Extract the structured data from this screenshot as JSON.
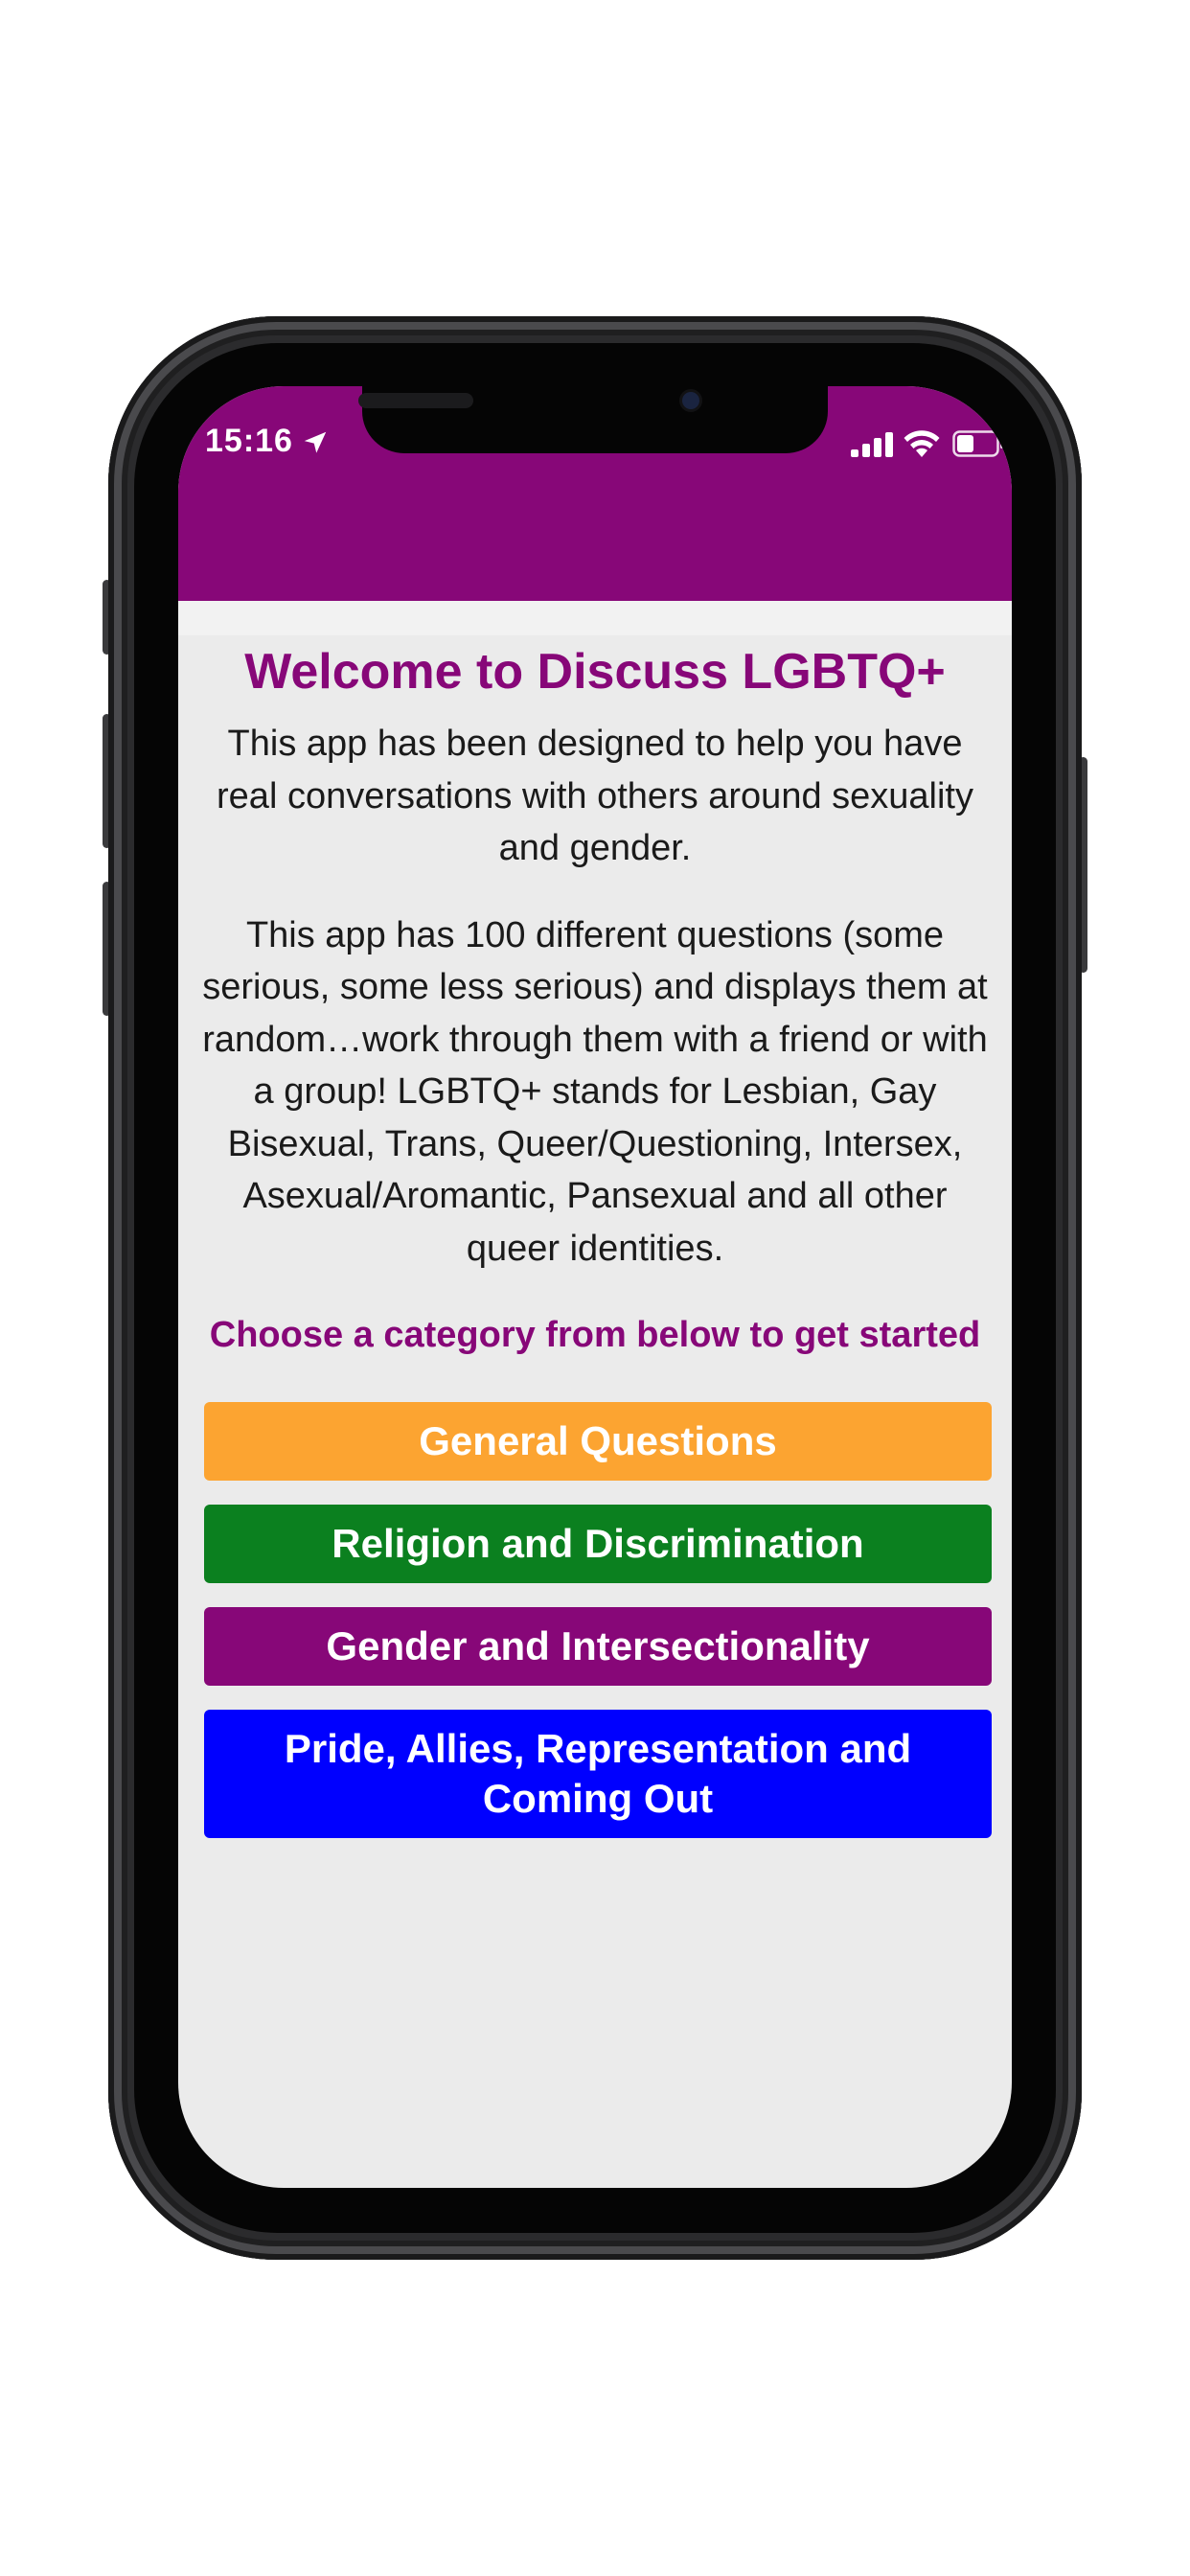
{
  "status_bar": {
    "time": "15:16",
    "icons": [
      "location-arrow-icon",
      "cellular-signal-icon",
      "wifi-icon",
      "battery-icon"
    ]
  },
  "colors": {
    "header": "#870778",
    "background": "#ebebeb",
    "accent_text": "#870778"
  },
  "welcome": {
    "title": "Welcome to Discuss LGBTQ+",
    "intro": "This app has been designed to help you have real conversations with others around sexuality and gender.",
    "description": "This app has 100 different questions (some serious, some less serious) and displays them at random…work through them with a friend or with a group! LGBTQ+ stands for Lesbian, Gay Bisexual, Trans, Queer/Questioning, Intersex, Asexual/Aromantic, Pansexual and all other queer identities.",
    "prompt": "Choose a category from below to get started"
  },
  "categories": [
    {
      "label": "General Questions",
      "color": "#fca431"
    },
    {
      "label": "Religion and Discrimination",
      "color": "#0b801f"
    },
    {
      "label": "Gender and Intersectionality",
      "color": "#870778"
    },
    {
      "label": "Pride, Allies, Representation and Coming Out",
      "color": "#0000ff"
    }
  ]
}
